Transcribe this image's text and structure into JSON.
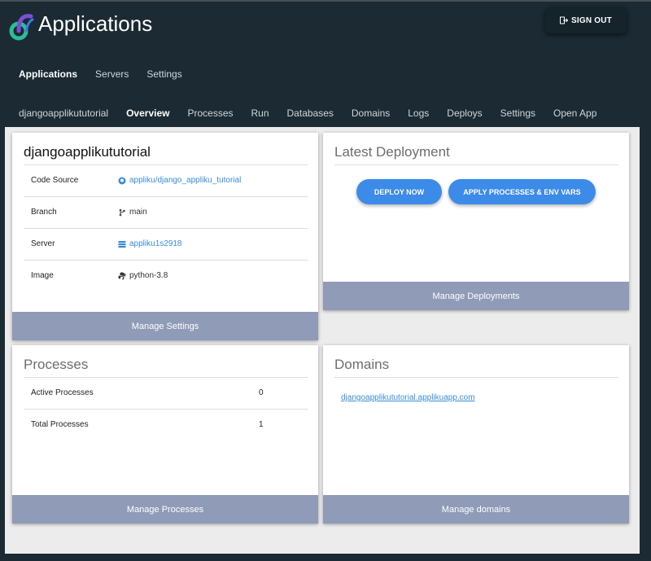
{
  "header": {
    "title": "Applications",
    "signout_label": "SIGN OUT",
    "logo_icon": "applikur-logo-icon",
    "signout_icon": "sign-out-icon"
  },
  "topnav": [
    {
      "label": "Applications",
      "active": true
    },
    {
      "label": "Servers",
      "active": false
    },
    {
      "label": "Settings",
      "active": false
    }
  ],
  "subnav": [
    {
      "label": "djangoapplikututorial",
      "active": false
    },
    {
      "label": "Overview",
      "active": true
    },
    {
      "label": "Processes",
      "active": false
    },
    {
      "label": "Run",
      "active": false
    },
    {
      "label": "Databases",
      "active": false
    },
    {
      "label": "Domains",
      "active": false
    },
    {
      "label": "Logs",
      "active": false
    },
    {
      "label": "Deploys",
      "active": false
    },
    {
      "label": "Settings",
      "active": false
    },
    {
      "label": "Open App",
      "active": false
    }
  ],
  "app_card": {
    "title": "djangoapplikututorial",
    "rows": [
      {
        "label": "Code Source",
        "value": "appliku/django_appliku_tutorial",
        "icon": "github-icon"
      },
      {
        "label": "Branch",
        "value": "main",
        "icon": "git-branch-icon"
      },
      {
        "label": "Server",
        "value": "appliku1s2918",
        "icon": "server-icon"
      },
      {
        "label": "Image",
        "value": "python-3.8",
        "icon": "python-icon"
      }
    ],
    "footer": "Manage Settings"
  },
  "deployment_card": {
    "title": "Latest Deployment",
    "deploy_label": "DEPLOY NOW",
    "apply_label": "APPLY PROCESSES & ENV VARS",
    "footer": "Manage Deployments"
  },
  "processes_card": {
    "title": "Processes",
    "rows": [
      {
        "label": "Active Processes",
        "value": "0"
      },
      {
        "label": "Total Processes",
        "value": "1"
      }
    ],
    "footer": "Manage Processes"
  },
  "domains_card": {
    "title": "Domains",
    "domain": "djangoapplikututorial.applikuapp.com",
    "footer": "Manage domains"
  },
  "colors": {
    "background": "#1b2a33",
    "content": "#ececec",
    "accent_button": "#3d8be8",
    "footer_button": "#8f9bb7",
    "link": "#3a8cd6"
  }
}
